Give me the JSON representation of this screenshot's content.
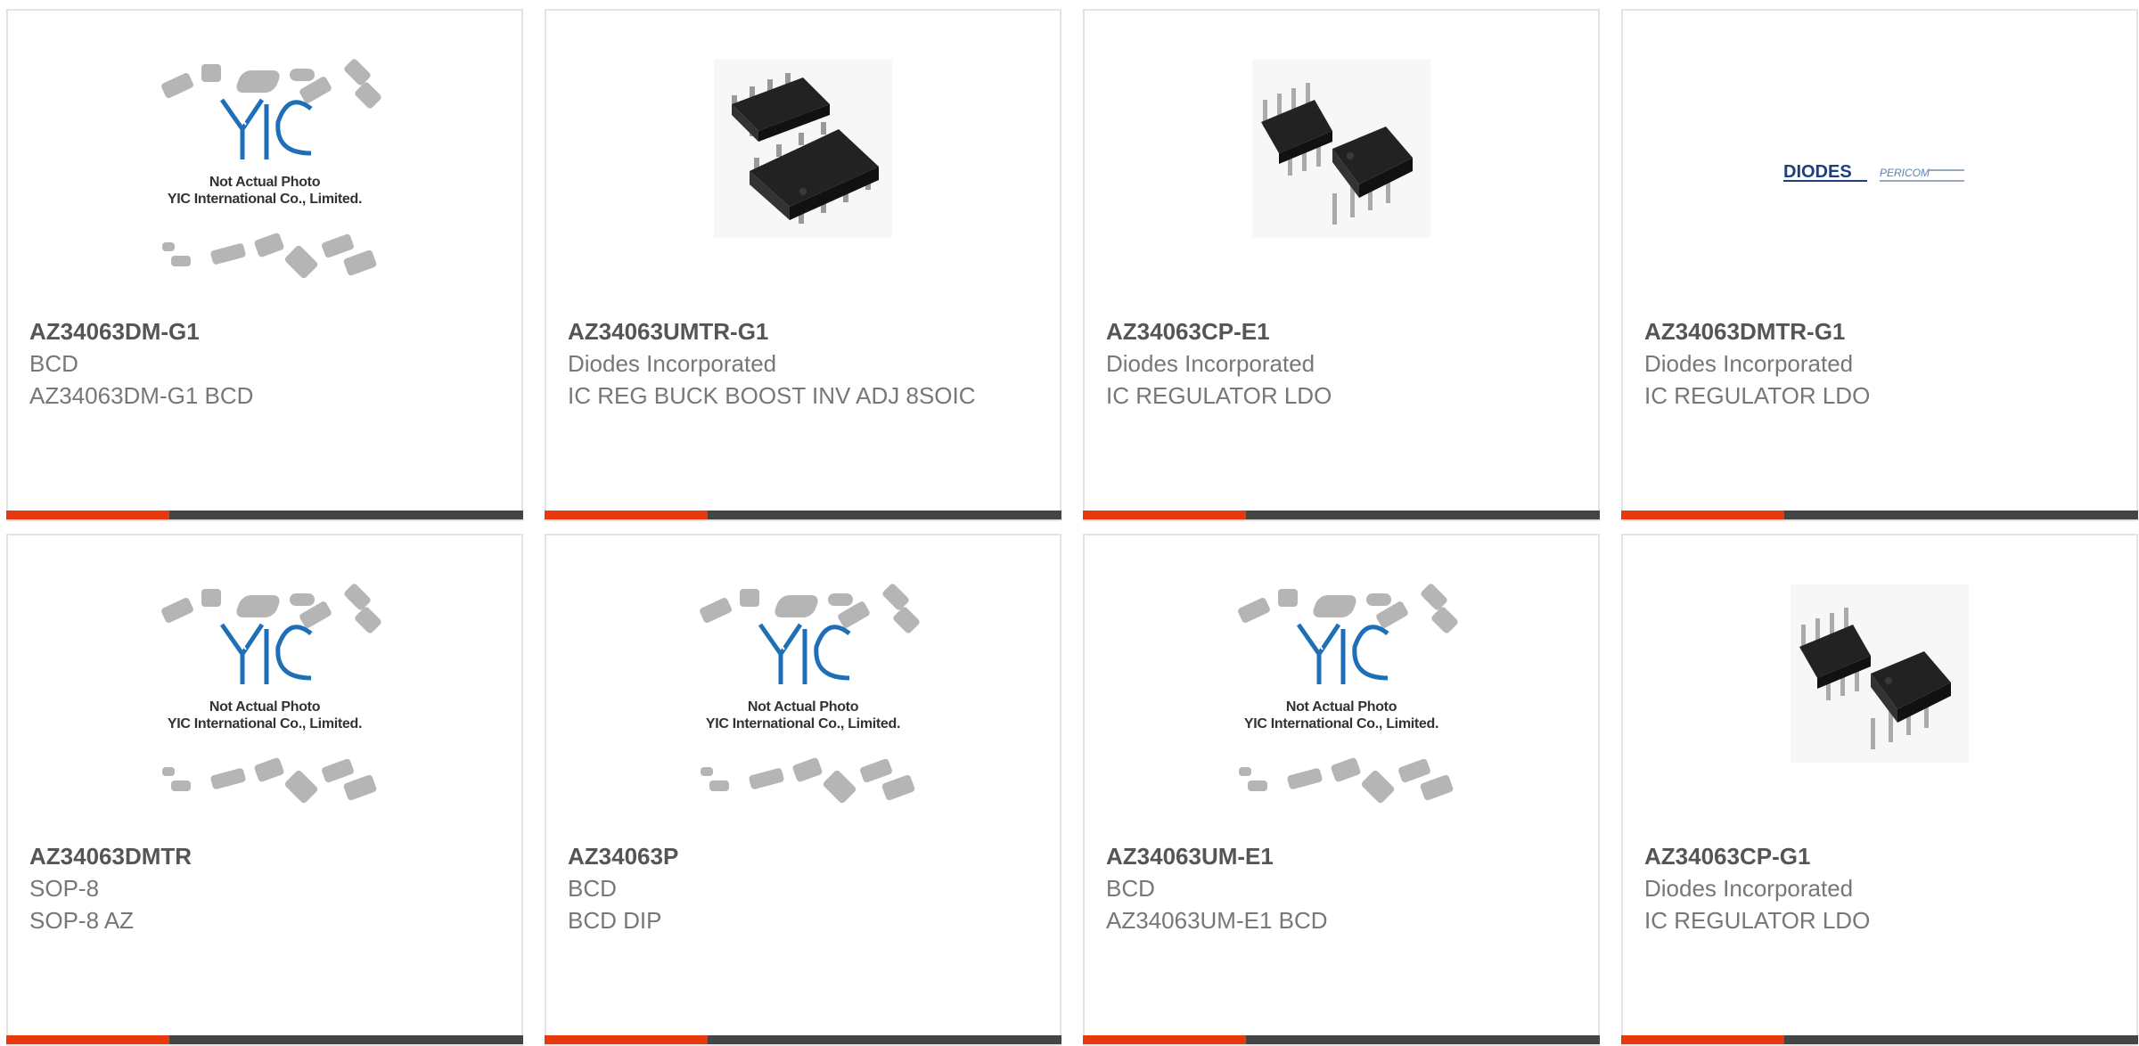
{
  "placeholder": {
    "line1": "Not Actual Photo",
    "line2": "YIC International Co., Limited."
  },
  "brand_logo": {
    "left": "DIODES",
    "right": "PERICOM"
  },
  "colors": {
    "accent": "#e8390e",
    "bar": "#444444",
    "border": "#e3e3e3",
    "yic_blue": "#1e6fb8"
  },
  "products": [
    {
      "part": "AZ34063DM-G1",
      "manufacturer": "BCD",
      "description": "AZ34063DM-G1 BCD",
      "image": "placeholder"
    },
    {
      "part": "AZ34063UMTR-G1",
      "manufacturer": "Diodes Incorporated",
      "description": "IC REG BUCK BOOST INV ADJ 8SOIC",
      "image": "soic-chip"
    },
    {
      "part": "AZ34063CP-E1",
      "manufacturer": "Diodes Incorporated",
      "description": "IC REGULATOR LDO",
      "image": "dip-chip"
    },
    {
      "part": "AZ34063DMTR-G1",
      "manufacturer": "Diodes Incorporated",
      "description": "IC REGULATOR LDO",
      "image": "diodes-logo"
    },
    {
      "part": "AZ34063DMTR",
      "manufacturer": "SOP-8",
      "description": "SOP-8 AZ",
      "image": "placeholder"
    },
    {
      "part": "AZ34063P",
      "manufacturer": "BCD",
      "description": "BCD DIP",
      "image": "placeholder"
    },
    {
      "part": "AZ34063UM-E1",
      "manufacturer": "BCD",
      "description": "AZ34063UM-E1 BCD",
      "image": "placeholder"
    },
    {
      "part": "AZ34063CP-G1",
      "manufacturer": "Diodes Incorporated",
      "description": "IC REGULATOR LDO",
      "image": "dip-chip"
    }
  ]
}
